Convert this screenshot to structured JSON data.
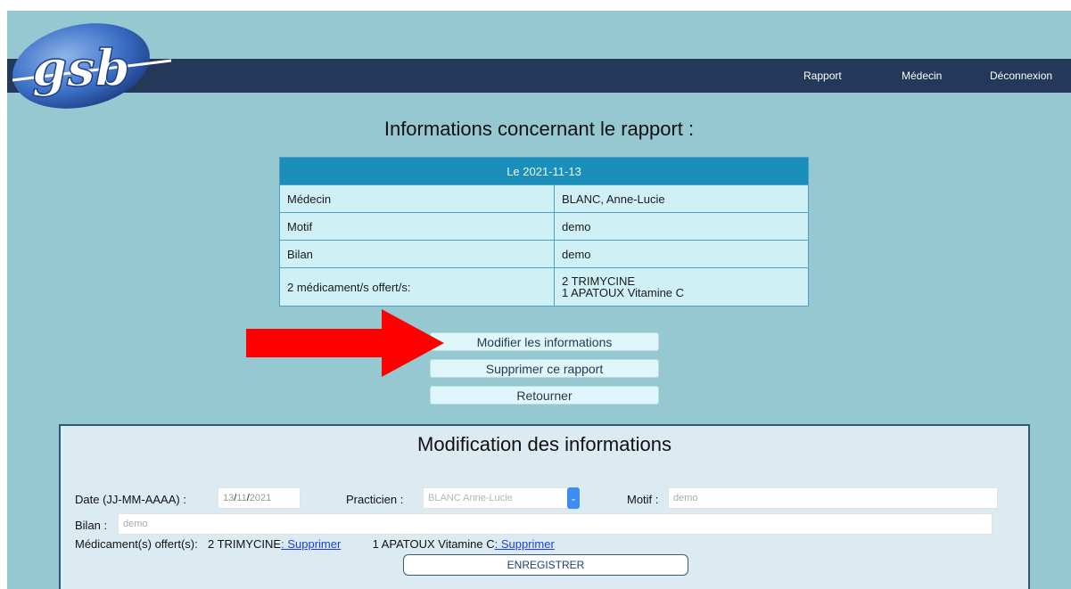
{
  "nav": {
    "rapport": "Rapport",
    "medecin": "Médecin",
    "deconnexion": "Déconnexion"
  },
  "logo": {
    "text": "gsb"
  },
  "title": "Informations concernant le rapport :",
  "info": {
    "header": "Le 2021-11-13",
    "rows": [
      {
        "label": "Médecin",
        "value": "BLANC, Anne-Lucie"
      },
      {
        "label": "Motif",
        "value": "demo"
      },
      {
        "label": "Bilan",
        "value": "demo"
      }
    ],
    "meds_label": "2 médicament/s offert/s:",
    "meds": [
      "2 TRIMYCINE",
      "1 APATOUX Vitamine C"
    ]
  },
  "buttons": {
    "modifier": "Modifier les informations",
    "supprimer": "Supprimer ce rapport",
    "retourner": "Retourner"
  },
  "form": {
    "title": "Modification des informations",
    "date_label": "Date (JJ-MM-AAAA) :",
    "date_day": "13",
    "date_month": "11",
    "date_year": "2021",
    "praticien_label": "Practicien :",
    "praticien_value": "BLANC Anne-Lucie",
    "motif_label": "Motif :",
    "motif_placeholder": "demo",
    "bilan_label": "Bilan :",
    "bilan_placeholder": "demo",
    "meds_label": "Médicament(s) offert(s):",
    "med1": "2 TRIMYCINE",
    "med1_link": ": Supprimer",
    "med2": "1 APATOUX Vitamine C",
    "med2_link": ": Supprimer",
    "save": "ENREGISTRER"
  },
  "colors": {
    "background": "#96c8d2",
    "navbar": "#24385a",
    "table_header": "#1a8fbc",
    "table_cell": "#cff1f5",
    "arrow": "#ff0000",
    "link": "#1a3fe0"
  }
}
